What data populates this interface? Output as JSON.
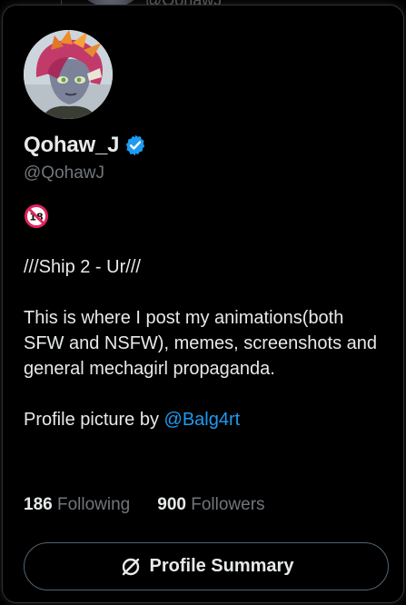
{
  "backdrop": {
    "handle": "@QohawJ"
  },
  "profile": {
    "display_name": "Qohaw_J",
    "handle": "@QohawJ",
    "verified": true,
    "avatar_icon": "mecha-girl-avatar"
  },
  "bio": {
    "age_badge_icon": "no-under-18-icon",
    "line1": "///Ship 2 - Ur///",
    "line2": "This is where I post my animations(both SFW and NSFW), memes, screenshots and general mechagirl propaganda.",
    "credit_prefix": "Profile picture by ",
    "credit_mention": "@Balg4rt"
  },
  "stats": {
    "following_count": "186",
    "following_label": "Following",
    "followers_count": "900",
    "followers_label": "Followers"
  },
  "summary_button": {
    "label": "Profile Summary",
    "icon": "slashed-circle-icon"
  },
  "colors": {
    "background": "#000000",
    "text": "#e7e9ea",
    "muted": "#71767b",
    "accent": "#1d9bf0",
    "border": "#2f3336"
  }
}
